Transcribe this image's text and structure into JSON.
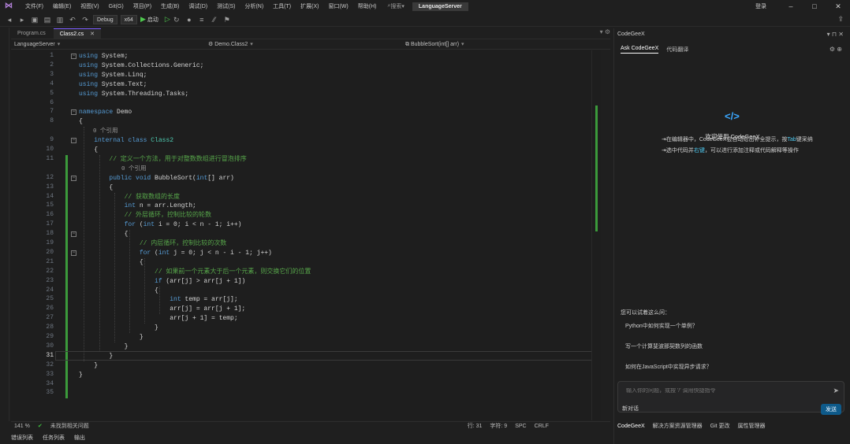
{
  "menubar": {
    "items": [
      "文件(F)",
      "编辑(E)",
      "视图(V)",
      "Git(G)",
      "项目(P)",
      "生成(B)",
      "调试(D)",
      "测试(S)",
      "分析(N)",
      "工具(T)",
      "扩展(X)",
      "窗口(W)",
      "帮助(H)"
    ],
    "search_label": "搜索",
    "project_name": "LanguageServer",
    "user": "登录"
  },
  "toolbar": {
    "config": "Debug",
    "platform": "x64",
    "run_label": "启动"
  },
  "editor": {
    "tabs": [
      {
        "label": "Program.cs",
        "active": false
      },
      {
        "label": "Class2.cs",
        "active": true
      }
    ],
    "nav": {
      "project": "LanguageServer",
      "class": "Demo.Class2",
      "member": "BubbleSort(int[] arr)"
    },
    "lines": [
      {
        "n": 1,
        "html": "<span class=\"kw\">using</span> System;"
      },
      {
        "n": 2,
        "html": "<span class=\"kw\">using</span> System.Collections.Generic;"
      },
      {
        "n": 3,
        "html": "<span class=\"kw\">using</span> System.Linq;"
      },
      {
        "n": 4,
        "html": "<span class=\"kw\">using</span> System.Text;"
      },
      {
        "n": 5,
        "html": "<span class=\"kw\">using</span> System.Threading.Tasks;"
      },
      {
        "n": 6,
        "html": ""
      },
      {
        "n": 7,
        "html": "<span class=\"kw\">namespace</span> Demo"
      },
      {
        "n": 8,
        "html": "{"
      },
      {
        "n": null,
        "lens": "0 个引用"
      },
      {
        "n": 9,
        "html": "    <span class=\"kw\">internal</span> <span class=\"kw\">class</span> <span class=\"tp\">Class2</span>"
      },
      {
        "n": 10,
        "html": "    {"
      },
      {
        "n": 11,
        "html": "        <span class=\"cm\">// 定义一个方法，用于对整数数组进行冒泡排序</span>"
      },
      {
        "n": null,
        "lens": "        0 个引用"
      },
      {
        "n": 12,
        "html": "        <span class=\"kw\">public</span> <span class=\"kw\">void</span> BubbleSort(<span class=\"kw\">int</span>[] arr)"
      },
      {
        "n": 13,
        "html": "        {"
      },
      {
        "n": 14,
        "html": "            <span class=\"cm\">// 获取数组的长度</span>"
      },
      {
        "n": 15,
        "html": "            <span class=\"kw\">int</span> n = arr.Length;"
      },
      {
        "n": 16,
        "html": "            <span class=\"cm\">// 外层循环，控制比较的轮数</span>"
      },
      {
        "n": 17,
        "html": "            <span class=\"kw\">for</span> (<span class=\"kw\">int</span> i = 0; i &lt; n - 1; i++)"
      },
      {
        "n": 18,
        "html": "            {"
      },
      {
        "n": 19,
        "html": "                <span class=\"cm\">// 内层循环，控制比较的次数</span>"
      },
      {
        "n": 20,
        "html": "                <span class=\"kw\">for</span> (<span class=\"kw\">int</span> j = 0; j &lt; n - i - 1; j++)"
      },
      {
        "n": 21,
        "html": "                {"
      },
      {
        "n": 22,
        "html": "                    <span class=\"cm\">// 如果前一个元素大于后一个元素，则交换它们的位置</span>"
      },
      {
        "n": 23,
        "html": "                    <span class=\"kw\">if</span> (arr[j] &gt; arr[j + 1])"
      },
      {
        "n": 24,
        "html": "                    {"
      },
      {
        "n": 25,
        "html": "                        <span class=\"kw\">int</span> temp = arr[j];"
      },
      {
        "n": 26,
        "html": "                        arr[j] = arr[j + 1];"
      },
      {
        "n": 27,
        "html": "                        arr[j + 1] = temp;"
      },
      {
        "n": 28,
        "html": "                    }"
      },
      {
        "n": 29,
        "html": "                }"
      },
      {
        "n": 30,
        "html": "            }"
      },
      {
        "n": 31,
        "html": "        }"
      },
      {
        "n": 32,
        "html": "    }"
      },
      {
        "n": 33,
        "html": "}"
      },
      {
        "n": 34,
        "html": ""
      },
      {
        "n": 35,
        "html": ""
      }
    ],
    "status": {
      "zoom": "141 %",
      "issues": "未找到相关问题",
      "line": "行: 31",
      "col": "字符: 9",
      "space": "SPC",
      "eol": "CRLF"
    }
  },
  "bottom_tabs": [
    "错误列表",
    "任务列表",
    "输出"
  ],
  "panel": {
    "title": "CodeGeeX",
    "tabs": [
      "Ask CodeGeeX",
      "代码翻译"
    ],
    "welcome": "欢迎使用 CodeGeeX",
    "hint1_pre": "⇥在编辑器中，CodeGeeX会自动给出补全提示，按",
    "hint1_key": "Tab",
    "hint1_post": "键采纳",
    "hint2_pre": "⇥选中代码并",
    "hint2_key": "右键",
    "hint2_post": "，可以进行添加注释或代码解释等操作",
    "suggest_head": "您可以试着这么问：",
    "suggestions": [
      "Python中如何实现一个单例？",
      "写一个计算斐波那契数列的函数",
      "如何在JavaScript中实现异步请求？"
    ],
    "input_placeholder": "输入你的问题，或按 '/' 调用快捷指令",
    "new_chat": "新对话",
    "send_label": "发送",
    "footer": [
      "CodeGeeX",
      "解决方案资源管理器",
      "Git 更改",
      "属性管理器"
    ]
  }
}
